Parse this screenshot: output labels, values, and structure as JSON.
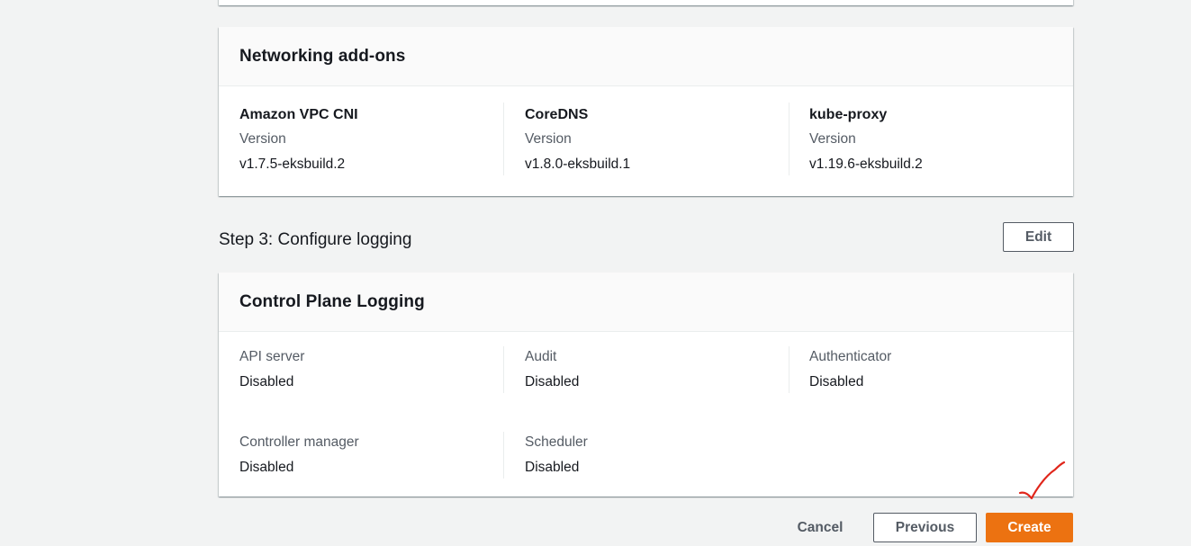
{
  "networking": {
    "title": "Networking add-ons",
    "addons": [
      {
        "name": "Amazon VPC CNI",
        "label": "Version",
        "value": "v1.7.5-eksbuild.2"
      },
      {
        "name": "CoreDNS",
        "label": "Version",
        "value": "v1.8.0-eksbuild.1"
      },
      {
        "name": "kube-proxy",
        "label": "Version",
        "value": "v1.19.6-eksbuild.2"
      }
    ]
  },
  "step3": {
    "title": "Step 3: Configure logging",
    "edit_label": "Edit"
  },
  "logging": {
    "title": "Control Plane Logging",
    "items": [
      {
        "label": "API server",
        "value": "Disabled"
      },
      {
        "label": "Audit",
        "value": "Disabled"
      },
      {
        "label": "Authenticator",
        "value": "Disabled"
      },
      {
        "label": "Controller manager",
        "value": "Disabled"
      },
      {
        "label": "Scheduler",
        "value": "Disabled"
      }
    ]
  },
  "footer": {
    "cancel_label": "Cancel",
    "previous_label": "Previous",
    "create_label": "Create"
  },
  "colors": {
    "primary_button": "#ec7211",
    "annotation": "#e0261b"
  }
}
